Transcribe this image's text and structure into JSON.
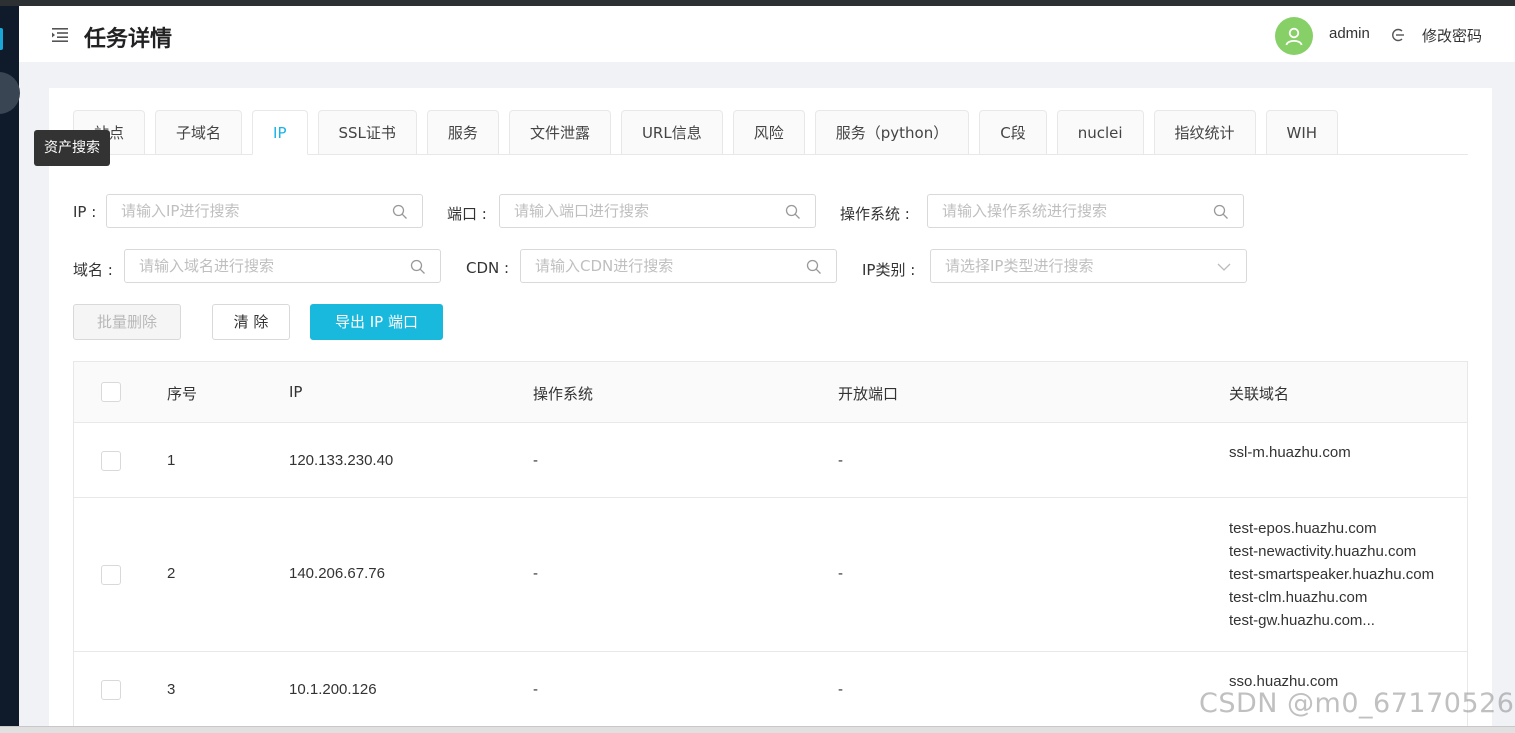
{
  "header": {
    "title": "任务详情",
    "username": "admin",
    "change_password": "修改密码",
    "avatar_color": "#87d068"
  },
  "tooltip": "资产搜索",
  "tabs": [
    {
      "label": "站点",
      "active": false
    },
    {
      "label": "子域名",
      "active": false
    },
    {
      "label": "IP",
      "active": true
    },
    {
      "label": "SSL证书",
      "active": false
    },
    {
      "label": "服务",
      "active": false
    },
    {
      "label": "文件泄露",
      "active": false
    },
    {
      "label": "URL信息",
      "active": false
    },
    {
      "label": "风险",
      "active": false
    },
    {
      "label": "服务（python）",
      "active": false
    },
    {
      "label": "C段",
      "active": false
    },
    {
      "label": "nuclei",
      "active": false
    },
    {
      "label": "指纹统计",
      "active": false
    },
    {
      "label": "WIH",
      "active": false
    }
  ],
  "filters": {
    "ip": {
      "label": "IP :",
      "placeholder": "请输入IP进行搜索",
      "icon": "search-icon"
    },
    "port": {
      "label": "端口 :",
      "placeholder": "请输入端口进行搜索",
      "icon": "search-icon"
    },
    "os": {
      "label": "操作系统 :",
      "placeholder": "请输入操作系统进行搜索",
      "icon": "search-icon"
    },
    "domain": {
      "label": "域名 :",
      "placeholder": "请输入域名进行搜索",
      "icon": "search-icon"
    },
    "cdn": {
      "label": "CDN :",
      "placeholder": "请输入CDN进行搜索",
      "icon": "search-icon"
    },
    "ip_type": {
      "label": "IP类别 :",
      "placeholder": "请选择IP类型进行搜索",
      "icon": "chevron-down-icon"
    }
  },
  "buttons": {
    "batch_delete": "批量删除",
    "clear": "清 除",
    "export": "导出 IP 端口"
  },
  "table": {
    "columns": [
      "序号",
      "IP",
      "操作系统",
      "开放端口",
      "关联域名"
    ],
    "rows": [
      {
        "index": "1",
        "ip": "120.133.230.40",
        "os": "-",
        "ports": "-",
        "domains": [
          "ssl-m.huazhu.com"
        ]
      },
      {
        "index": "2",
        "ip": "140.206.67.76",
        "os": "-",
        "ports": "-",
        "domains": [
          "test-epos.huazhu.com",
          "test-newactivity.huazhu.com",
          "test-smartspeaker.huazhu.com",
          "test-clm.huazhu.com",
          "test-gw.huazhu.com..."
        ]
      },
      {
        "index": "3",
        "ip": "10.1.200.126",
        "os": "-",
        "ports": "-",
        "domains": [
          "sso.huazhu.com"
        ]
      }
    ]
  },
  "watermark": "CSDN @m0_67170526",
  "colors": {
    "accent": "#19b8dd",
    "sidebar": "#0f1b2a"
  }
}
